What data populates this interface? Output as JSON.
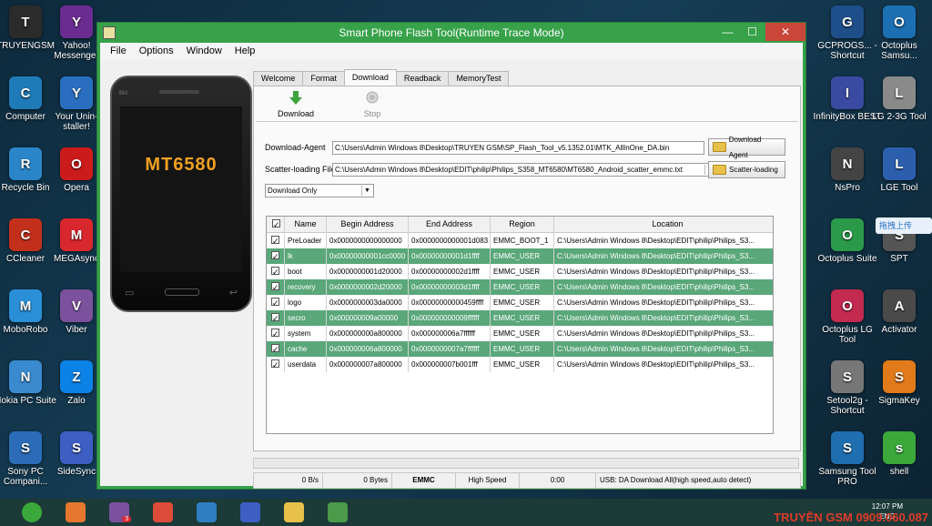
{
  "desktop": {
    "left_icons": [
      {
        "label": "TRUYENGSM",
        "icon": "app-icon",
        "color": "#2b2b2b"
      },
      {
        "label": "Yahoo! Messenger",
        "icon": "yahoo-icon",
        "color": "#6a2c91"
      },
      {
        "label": "Computer",
        "icon": "computer-icon",
        "color": "#1f7bb8"
      },
      {
        "label": "Your Unin-staller!",
        "icon": "uninstaller-icon",
        "color": "#2a6fbf"
      },
      {
        "label": "Recycle Bin",
        "icon": "recycle-bin-icon",
        "color": "#2a86c8"
      },
      {
        "label": "Opera",
        "icon": "opera-icon",
        "color": "#cc1b1b"
      },
      {
        "label": "CCleaner",
        "icon": "ccleaner-icon",
        "color": "#c2301c"
      },
      {
        "label": "MEGAsync",
        "icon": "mega-icon",
        "color": "#d9272e"
      },
      {
        "label": "MoboRobo",
        "icon": "moborobo-icon",
        "color": "#2a8fd6"
      },
      {
        "label": "Viber",
        "icon": "viber-icon",
        "color": "#7b519d"
      },
      {
        "label": "Nokia PC Suite",
        "icon": "nokia-icon",
        "color": "#3a8ad0"
      },
      {
        "label": "Zalo",
        "icon": "zalo-icon",
        "color": "#0b82e6"
      },
      {
        "label": "Sony PC Compani...",
        "icon": "sony-icon",
        "color": "#2b6cb8"
      },
      {
        "label": "SideSync",
        "icon": "sidesync-icon",
        "color": "#3d5fc4"
      }
    ],
    "right_icons": [
      {
        "label": "GCPROGS... - Shortcut",
        "icon": "gcpro-icon",
        "color": "#1e4f8a"
      },
      {
        "label": "Octoplus Samsu...",
        "icon": "octoplus-icon",
        "color": "#1c6fb3"
      },
      {
        "label": "InfinityBox BEST",
        "icon": "infinitybox-icon",
        "color": "#3a4aa0"
      },
      {
        "label": "LG 2-3G Tool",
        "icon": "lg-tool-icon",
        "color": "#8a8a8a"
      },
      {
        "label": "NsPro",
        "icon": "nspro-icon",
        "color": "#444444"
      },
      {
        "label": "LGE Tool",
        "icon": "lge-tool-icon",
        "color": "#2b5fae"
      },
      {
        "label": "Octoplus Suite",
        "icon": "octoplus-suite-icon",
        "color": "#2a9a4a"
      },
      {
        "label": "SPT",
        "icon": "spt-icon",
        "color": "#555555"
      },
      {
        "label": "Octoplus LG Tool",
        "icon": "octoplus-lg-icon",
        "color": "#c22a50"
      },
      {
        "label": "Activator",
        "icon": "activator-icon",
        "color": "#4a4a4a"
      },
      {
        "label": "Setool2g - Shortcut",
        "icon": "setool-icon",
        "color": "#777777"
      },
      {
        "label": "SigmaKey",
        "icon": "sigmakey-icon",
        "color": "#e07a1a"
      },
      {
        "label": "Samsung Tool PRO",
        "icon": "samsung-tool-icon",
        "color": "#1f6fb0"
      },
      {
        "label": "shell",
        "icon": "shell-icon",
        "color": "#3aa83a"
      }
    ],
    "floating_badge": "拖拽上传"
  },
  "window": {
    "title": "Smart Phone Flash Tool(Runtime Trace Mode)",
    "minimize": "—",
    "maximize": "☐",
    "close": "✕",
    "menu": [
      "File",
      "Options",
      "Window",
      "Help"
    ],
    "phone_brand": "MT6580",
    "phone_small": "BM",
    "tabs": [
      "Welcome",
      "Format",
      "Download",
      "Readback",
      "MemoryTest"
    ],
    "active_tab": "Download",
    "toolbar": {
      "download_label": "Download",
      "stop_label": "Stop"
    },
    "download_agent": {
      "label": "Download-Agent",
      "value": "C:\\Users\\Admin Windows 8\\Desktop\\TRUYEN GSM\\SP_Flash_Tool_v5.1352.01\\MTK_AllInOne_DA.bin",
      "button": "Download Agent"
    },
    "scatter": {
      "label": "Scatter-loading File",
      "value": "C:\\Users\\Admin Windows 8\\Desktop\\EDIT\\philip\\Philips_S358_MT6580\\MT6580_Android_scatter_emmc.txt",
      "button": "Scatter-loading"
    },
    "mode": "Download Only",
    "table": {
      "columns": [
        "",
        "Name",
        "Begin Address",
        "End Address",
        "Region",
        "Location"
      ],
      "rows": [
        {
          "checked": true,
          "name": "PreLoader",
          "begin": "0x0000000000000000",
          "end": "0x0000000000001d083",
          "region": "EMMC_BOOT_1",
          "location": "C:\\Users\\Admin Windows 8\\Desktop\\EDIT\\philip\\Philips_S3..."
        },
        {
          "checked": true,
          "name": "lk",
          "begin": "0x00000000001cc0000",
          "end": "0x00000000001d1ffff",
          "region": "EMMC_USER",
          "location": "C:\\Users\\Admin Windows 8\\Desktop\\EDIT\\philip\\Philips_S3..."
        },
        {
          "checked": true,
          "name": "boot",
          "begin": "0x0000000001d20000",
          "end": "0x00000000002d1ffff",
          "region": "EMMC_USER",
          "location": "C:\\Users\\Admin Windows 8\\Desktop\\EDIT\\philip\\Philips_S3..."
        },
        {
          "checked": true,
          "name": "recovery",
          "begin": "0x0000000002d20000",
          "end": "0x00000000003d1ffff",
          "region": "EMMC_USER",
          "location": "C:\\Users\\Admin Windows 8\\Desktop\\EDIT\\philip\\Philips_S3..."
        },
        {
          "checked": true,
          "name": "logo",
          "begin": "0x0000000003da0000",
          "end": "0x00000000000459ffff",
          "region": "EMMC_USER",
          "location": "C:\\Users\\Admin Windows 8\\Desktop\\EDIT\\philip\\Philips_S3..."
        },
        {
          "checked": true,
          "name": "secro",
          "begin": "0x000000009a00000",
          "end": "0x000000000009ffffff",
          "region": "EMMC_USER",
          "location": "C:\\Users\\Admin Windows 8\\Desktop\\EDIT\\philip\\Philips_S3..."
        },
        {
          "checked": true,
          "name": "system",
          "begin": "0x000000000a800000",
          "end": "0x000000006a7ffffff",
          "region": "EMMC_USER",
          "location": "C:\\Users\\Admin Windows 8\\Desktop\\EDIT\\philip\\Philips_S3..."
        },
        {
          "checked": true,
          "name": "cache",
          "begin": "0x000000006a800000",
          "end": "0x0000000007a7ffffff",
          "region": "EMMC_USER",
          "location": "C:\\Users\\Admin Windows 8\\Desktop\\EDIT\\philip\\Philips_S3..."
        },
        {
          "checked": true,
          "name": "userdata",
          "begin": "0x000000007a800000",
          "end": "0x000000007b001fff",
          "region": "EMMC_USER",
          "location": "C:\\Users\\Admin Windows 8\\Desktop\\EDIT\\philip\\Philips_S3..."
        }
      ]
    },
    "status": {
      "speed": "0 B/s",
      "bytes": "0 Bytes",
      "storage": "EMMC",
      "usb_speed": "High Speed",
      "time": "0:00",
      "message": "USB: DA Download All(high speed,auto detect)"
    }
  },
  "taskbar": {
    "apps": [
      "start-icon",
      "firefox-icon",
      "viber-icon",
      "chrome-icon",
      "upload-icon",
      "sidesync-icon",
      "explorer-icon",
      "flashtool-icon"
    ],
    "viber_badge": "3",
    "clock_time": "12:07 PM",
    "lang": "ENG"
  },
  "watermark": "TRUYỀN GSM 0909.060.087",
  "colors": {
    "window_frame": "#37a24a",
    "row_highlight": "#5aa77a",
    "close_button": "#c9473a"
  }
}
